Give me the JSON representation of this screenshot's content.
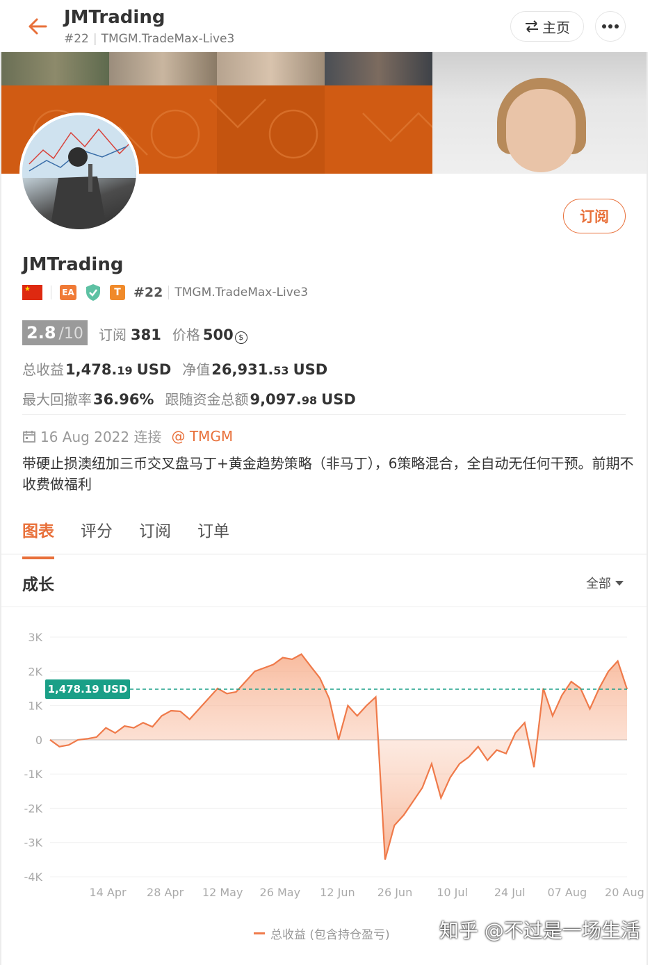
{
  "header": {
    "title": "JMTrading",
    "rank": "#22",
    "server": "TMGM.TradeMax-Live3",
    "home_label": "主页"
  },
  "profile": {
    "name": "JMTrading",
    "subscribe_label": "订阅",
    "badges": {
      "ea": "EA",
      "t": "T"
    },
    "rank": "#22",
    "server": "TMGM.TradeMax-Live3",
    "rating": "2.8",
    "rating_max": "/10",
    "subscriptions_label": "订阅",
    "subscriptions": "381",
    "price_label": "价格",
    "price": "500",
    "total_profit_label": "总收益",
    "total_profit_int": "1,478.",
    "total_profit_dec": "19",
    "total_profit_unit": "USD",
    "equity_label": "净值",
    "equity_int": "26,931.",
    "equity_dec": "53",
    "equity_unit": "USD",
    "max_drawdown_label": "最大回撤率",
    "max_drawdown": "36.96%",
    "follow_funds_label": "跟随资金总额",
    "follow_funds_int": "9,097.",
    "follow_funds_dec": "98",
    "follow_funds_unit": "USD",
    "joined": "16 Aug 2022 连接",
    "broker": "@ TMGM",
    "description": "带硬止损澳纽加三币交叉盘马丁+黄金趋势策略（非马丁），6策略混合，全自动无任何干预。前期不收费做福利"
  },
  "tabs": [
    "图表",
    "评分",
    "订阅",
    "订单"
  ],
  "section": {
    "title": "成长",
    "range": "全部"
  },
  "colors": {
    "accent": "#e8703a",
    "series": "#ef7a4a",
    "marker": "#1a9f87"
  },
  "chart_data": {
    "type": "area",
    "yticks": [
      "3K",
      "2K",
      "1K",
      "0",
      "-1K",
      "-2K",
      "-3K",
      "-4K"
    ],
    "ylim": [
      -4000,
      3000
    ],
    "xticks": [
      "14 Apr",
      "28 Apr",
      "12 May",
      "26 May",
      "12 Jun",
      "26 Jun",
      "10 Jul",
      "24 Jul",
      "07 Aug",
      "20 Aug"
    ],
    "current_value": 1478.19,
    "current_label": "1,478.19 USD",
    "series": [
      {
        "name": "总收益 (包含持仓盈亏)",
        "values": [
          0,
          -200,
          -150,
          0,
          30,
          80,
          350,
          200,
          400,
          350,
          500,
          380,
          700,
          850,
          830,
          600,
          900,
          1200,
          1500,
          1350,
          1400,
          1700,
          2000,
          2100,
          2200,
          2400,
          2350,
          2500,
          2150,
          1800,
          1200,
          0,
          1000,
          700,
          1000,
          1250,
          -3500,
          -2500,
          -2200,
          -1800,
          -1400,
          -700,
          -1700,
          -1100,
          -700,
          -500,
          -200,
          -600,
          -300,
          -400,
          200,
          500,
          -800,
          1500,
          700,
          1300,
          1700,
          1500,
          900,
          1500,
          2000,
          2300,
          1478
        ]
      }
    ]
  },
  "watermark": "知乎 @不过是一场生活"
}
